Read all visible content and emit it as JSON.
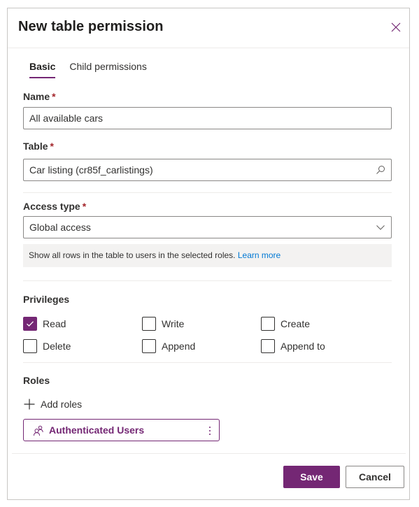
{
  "dialog": {
    "title": "New table permission",
    "close_icon": "close-icon"
  },
  "tabs": [
    {
      "label": "Basic",
      "active": true
    },
    {
      "label": "Child permissions",
      "active": false
    }
  ],
  "form": {
    "name": {
      "label": "Name",
      "required_mark": "*",
      "value": "All available cars"
    },
    "table": {
      "label": "Table",
      "required_mark": "*",
      "value": "Car listing (cr85f_carlistings)",
      "icon": "search-icon"
    },
    "access_type": {
      "label": "Access type",
      "required_mark": "*",
      "selected": "Global access",
      "icon": "chevron-down-icon",
      "description": "Show all rows in the table to users in the selected roles.",
      "learn_more": "Learn more"
    }
  },
  "privileges": {
    "label": "Privileges",
    "items": [
      {
        "label": "Read",
        "checked": true
      },
      {
        "label": "Write",
        "checked": false
      },
      {
        "label": "Create",
        "checked": false
      },
      {
        "label": "Delete",
        "checked": false
      },
      {
        "label": "Append",
        "checked": false
      },
      {
        "label": "Append to",
        "checked": false
      }
    ]
  },
  "roles": {
    "label": "Roles",
    "add_label": "Add roles",
    "items": [
      {
        "name": "Authenticated Users",
        "icon": "people-icon"
      }
    ]
  },
  "footer": {
    "save_label": "Save",
    "cancel_label": "Cancel"
  },
  "colors": {
    "accent": "#742774",
    "link": "#0078d4",
    "required": "#a4262c"
  }
}
